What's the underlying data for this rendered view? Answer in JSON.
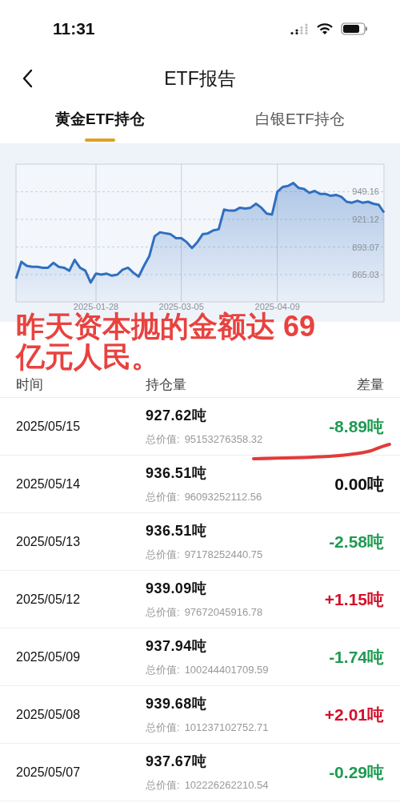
{
  "status_bar": {
    "time": "11:31"
  },
  "header": {
    "title": "ETF报告"
  },
  "tabs": [
    {
      "label": "黄金ETF持仓",
      "selected": true
    },
    {
      "label": "白银ETF持仓",
      "selected": false
    }
  ],
  "chart": {
    "chart_data": {
      "type": "area",
      "grid": true,
      "yticks": [
        865.03,
        893.07,
        921.12,
        949.16
      ],
      "ylim": [
        837.4,
        977.2
      ],
      "categories": [
        null,
        null,
        null,
        null,
        null,
        null,
        null,
        null,
        null,
        null,
        null,
        null,
        null,
        null,
        null,
        "2025-01-28",
        null,
        null,
        null,
        null,
        null,
        null,
        null,
        null,
        null,
        null,
        null,
        null,
        null,
        null,
        null,
        "2025-03-05",
        null,
        null,
        null,
        null,
        null,
        null,
        null,
        null,
        null,
        null,
        null,
        null,
        null,
        null,
        null,
        null,
        null,
        "2025-04-09",
        null,
        null,
        null,
        null,
        null,
        null,
        null,
        null,
        null,
        null,
        null,
        null,
        null,
        null,
        null,
        null,
        null,
        null,
        null,
        null
      ],
      "series": [
        {
          "color": "#2f6fc0",
          "values": [
            861,
            878,
            874,
            873,
            873,
            872,
            872,
            877,
            873,
            872,
            869,
            880,
            872,
            869,
            857,
            866,
            865,
            866,
            864,
            865,
            870,
            872,
            867,
            863,
            874,
            884,
            904,
            908,
            907,
            906,
            902,
            902,
            898,
            892,
            898,
            906,
            907,
            910,
            911,
            931,
            930,
            930,
            933,
            932,
            933,
            937,
            933,
            927,
            926,
            949,
            954,
            955,
            958,
            953,
            952,
            948,
            950,
            947,
            947,
            945,
            946,
            944,
            939,
            938,
            940,
            938,
            939,
            937,
            936,
            928
          ]
        }
      ]
    }
  },
  "annotation": {
    "text": "昨天资本抛的金额达 69 亿元人民。"
  },
  "table": {
    "columns": [
      "时间",
      "持仓量",
      "差量"
    ],
    "rows": [
      {
        "date": "2025/05/15",
        "holding": "927.62吨",
        "value_label": "总价值:",
        "value": "95153276358.32",
        "change": "-8.89吨",
        "color": "#1f9a52",
        "underlined": true
      },
      {
        "date": "2025/05/14",
        "holding": "936.51吨",
        "value_label": "总价值:",
        "value": "96093252112.56",
        "change": "0.00吨",
        "color": "#111111",
        "underlined": false
      },
      {
        "date": "2025/05/13",
        "holding": "936.51吨",
        "value_label": "总价值:",
        "value": "97178252440.75",
        "change": "-2.58吨",
        "color": "#1f9a52",
        "underlined": false
      },
      {
        "date": "2025/05/12",
        "holding": "939.09吨",
        "value_label": "总价值:",
        "value": "97672045916.78",
        "change": "+1.15吨",
        "color": "#d0112b",
        "underlined": false
      },
      {
        "date": "2025/05/09",
        "holding": "937.94吨",
        "value_label": "总价值:",
        "value": "100244401709.59",
        "change": "-1.74吨",
        "color": "#1f9a52",
        "underlined": false
      },
      {
        "date": "2025/05/08",
        "holding": "939.68吨",
        "value_label": "总价值:",
        "value": "101237102752.71",
        "change": "+2.01吨",
        "color": "#d0112b",
        "underlined": false
      },
      {
        "date": "2025/05/07",
        "holding": "937.67吨",
        "value_label": "总价值:",
        "value": "102226262210.54",
        "change": "-0.29吨",
        "color": "#1f9a52",
        "underlined": false
      }
    ]
  }
}
